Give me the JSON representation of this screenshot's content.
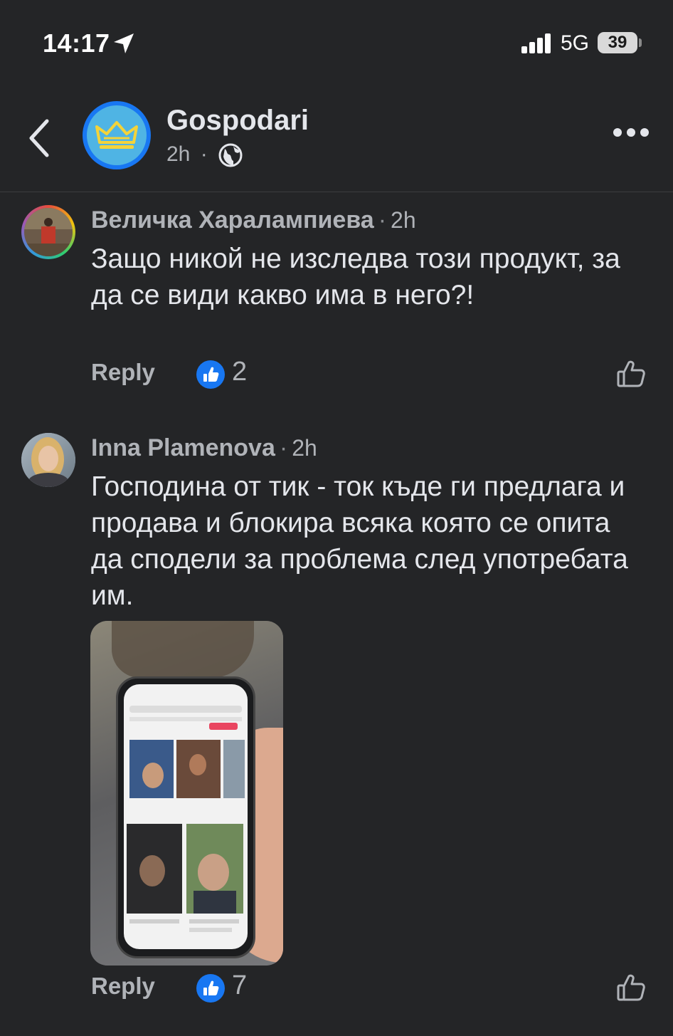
{
  "status_bar": {
    "time": "14:17",
    "network": "5G",
    "battery": "39"
  },
  "header": {
    "page_name": "Gospodari",
    "meta_time": "2h",
    "meta_sep": "·"
  },
  "comments": [
    {
      "author": "Величка Харалампиева",
      "sep": "·",
      "time": "2h",
      "text": "Защо никой не изследва този продукт, за да се види какво има в него?!",
      "reply_label": "Reply",
      "likes": "2"
    },
    {
      "author": "Inna Plamenova",
      "sep": "·",
      "time": "2h",
      "text": "Господина от тик - ток къде ги предлага и продава и блокира всяка която се опита да сподели за проблема след употребата им.",
      "reply_label": "Reply",
      "likes": "7"
    }
  ],
  "colors": {
    "background": "#242527",
    "like_blue": "#1877f2",
    "secondary_text": "#b0b3b8"
  },
  "icons": [
    "location-arrow-icon",
    "signal-icon",
    "battery-icon",
    "back-chevron-icon",
    "crown-icon",
    "globe-icon",
    "more-dots-icon",
    "like-badge-icon",
    "thumbs-up-outline-icon"
  ]
}
